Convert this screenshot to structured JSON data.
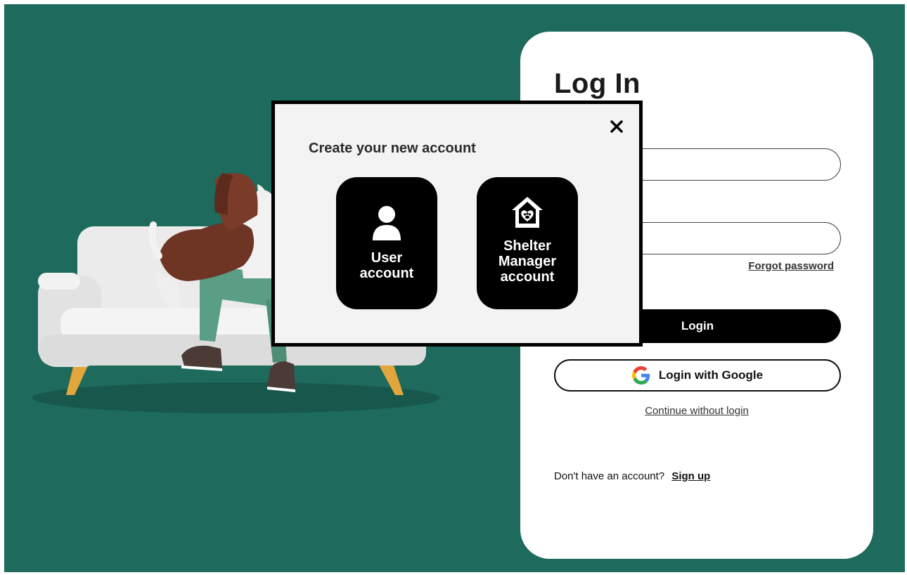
{
  "login": {
    "title": "Log In",
    "email_value": "",
    "password_value": "",
    "forgot_password": "Forgot password",
    "login_button": "Login",
    "google_button": "Login with Google",
    "continue_without_login": "Continue without login",
    "no_account_text": "Don't have an account?",
    "sign_up": "Sign up"
  },
  "modal": {
    "title": "Create your new account",
    "close_glyph": "✕",
    "user_account_label": "User account",
    "shelter_account_label": "Shelter Manager account"
  },
  "icons": {
    "close": "close-icon",
    "user": "user-icon",
    "shelter": "house-paw-icon",
    "google": "google-g-icon"
  },
  "colors": {
    "background": "#1e6a5c",
    "card": "#ffffff",
    "modal": "#f3f3f3",
    "primary": "#000000",
    "google_blue": "#4285F4",
    "google_red": "#EA4335",
    "google_yellow": "#FBBC05",
    "google_green": "#34A853"
  }
}
